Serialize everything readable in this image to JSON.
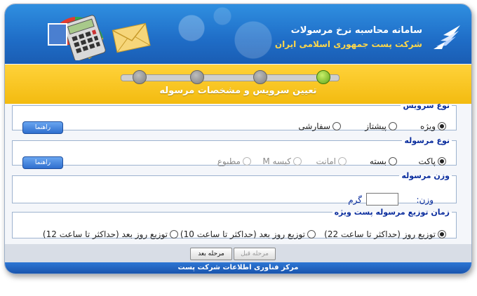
{
  "header": {
    "title": "سامانه محاسبه نرخ مرسولات",
    "subtitle": "شرکت پست جمهوری اسلامی ایران",
    "logo_icon": "post-bird-logo-icon"
  },
  "steps": {
    "current_label": "تعیین سرویس و مشخصات مرسوله",
    "total": 4,
    "active_index": 3
  },
  "service_type": {
    "legend": "نوع سرویس",
    "help_label": "راهنما",
    "options": [
      {
        "label": "ویژه",
        "checked": true,
        "disabled": false
      },
      {
        "label": "پیشتاز",
        "checked": false,
        "disabled": false
      },
      {
        "label": "سفارشی",
        "checked": false,
        "disabled": false
      }
    ]
  },
  "parcel_type": {
    "legend": "نوع مرسوله",
    "help_label": "راهنما",
    "options": [
      {
        "label": "پاکت",
        "checked": true,
        "disabled": false
      },
      {
        "label": "بسته",
        "checked": false,
        "disabled": false
      },
      {
        "label": "امانت",
        "checked": false,
        "disabled": true
      },
      {
        "label": "کیسه M",
        "checked": false,
        "disabled": true
      },
      {
        "label": "مطبوع",
        "checked": false,
        "disabled": true
      }
    ]
  },
  "weight": {
    "legend": "وزن مرسوله",
    "label": "وزن:",
    "value": "",
    "unit": "گرم"
  },
  "delivery": {
    "legend": "زمان توزیع مرسوله پست ویژه",
    "options": [
      {
        "label": "توزیع روز (حداکثر تا ساعت 22)",
        "checked": true
      },
      {
        "label": "توزیع روز بعد (حداکثر تا ساعت 10)",
        "checked": false
      },
      {
        "label": "توزیع روز بعد (حداکثر تا ساعت 12)",
        "checked": false
      }
    ]
  },
  "nav": {
    "prev_label": "مرحله قبل",
    "next_label": "مرحله بعد"
  },
  "footer": {
    "text": "مرکز فناوری اطلاعات شرکت پست"
  },
  "colors": {
    "header_blue": "#1f6dc7",
    "step_yellow": "#f3bb10",
    "legend_blue": "#0b2e9e",
    "active_step_green": "#5fa316"
  }
}
